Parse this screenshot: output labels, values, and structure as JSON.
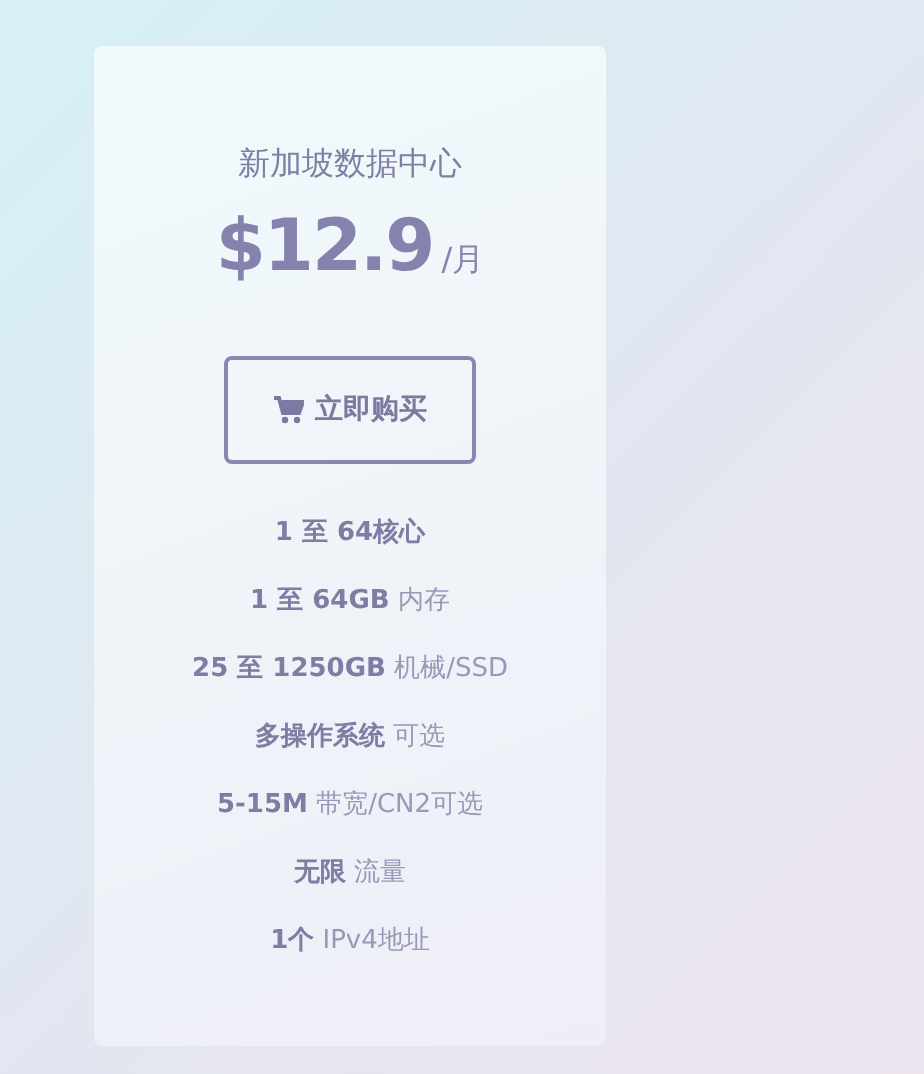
{
  "plan": {
    "title": "新加坡数据中心",
    "price": "$12.9",
    "period": "/月",
    "buy_button": "立即购买",
    "features": [
      "**1 至 64核心**",
      "**1 至 64GB** 内存",
      "**25 至 1250GB** 机械/SSD",
      "**多操作系统** 可选",
      "**5-15M** 带宽/CN2可选",
      "**无限** 流量",
      "**1个** IPv4地址"
    ]
  }
}
